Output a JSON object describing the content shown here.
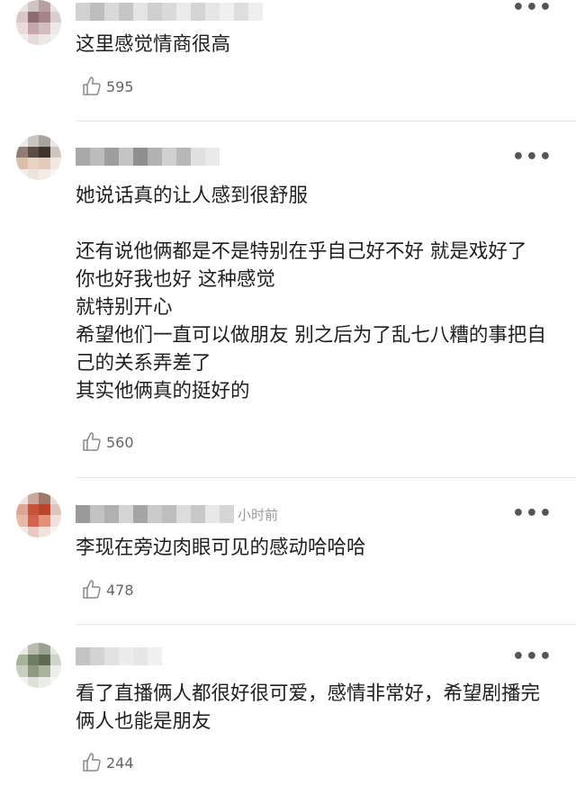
{
  "comments": [
    {
      "text": "这里感觉情商很高",
      "likes": "595",
      "time_ago": "",
      "more_icon": "more-horizontal-icon",
      "like_icon": "thumbs-up-icon"
    },
    {
      "text": "她说话真的让人感到很舒服\n\n还有说他俩都是不是特别在乎自己好不好 就是戏好了 你也好我也好 这种感觉\n就特别开心\n希望他们一直可以做朋友 别之后为了乱七八糟的事把自己的关系弄差了\n其实他俩真的挺好的",
      "likes": "560",
      "time_ago": "",
      "more_icon": "more-horizontal-icon",
      "like_icon": "thumbs-up-icon"
    },
    {
      "text": "李现在旁边肉眼可见的感动哈哈哈",
      "likes": "478",
      "time_ago": "小时前",
      "more_icon": "more-horizontal-icon",
      "like_icon": "thumbs-up-icon"
    },
    {
      "text": "看了直播俩人都很好很可爱，感情非常好，希望剧播完俩人也能是朋友",
      "likes": "244",
      "time_ago": "",
      "more_icon": "more-horizontal-icon",
      "like_icon": "thumbs-up-icon"
    }
  ]
}
